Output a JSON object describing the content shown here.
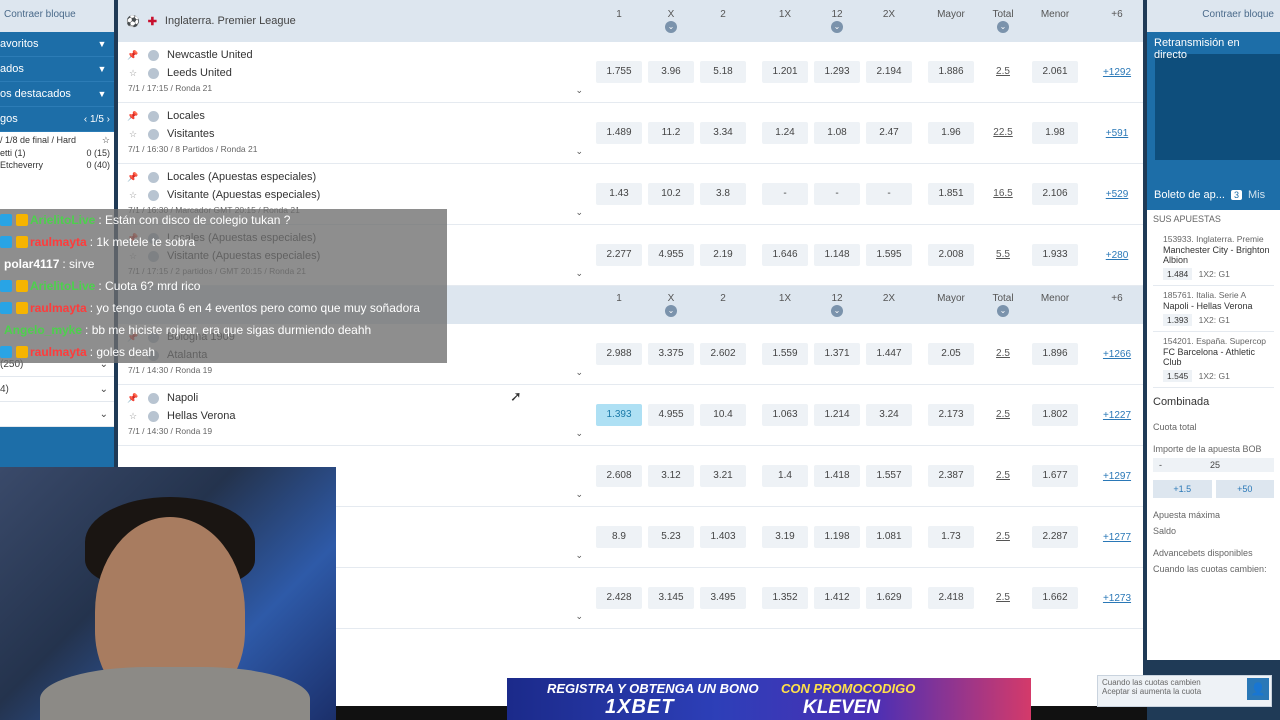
{
  "left_sidebar": {
    "collapse_label": "Contraer bloque",
    "items": [
      {
        "label": "avoritos"
      },
      {
        "label": "ados"
      },
      {
        "label": "os destacados"
      }
    ],
    "games_label": "gos",
    "games_page": "1/5",
    "live_lines": [
      {
        "left": "/ 1/8 de final / Hard",
        "right": ""
      },
      {
        "left": "etti (1)",
        "right": "0 (15)"
      },
      {
        "left": "Etcheverry",
        "right": "0 (40)"
      }
    ],
    "extra_rows": [
      {
        "label": "(250)"
      },
      {
        "label": "4)"
      },
      {
        "label": ""
      }
    ]
  },
  "league": {
    "name": "Inglaterra. Premier League",
    "columns": [
      "1",
      "X",
      "2",
      "1X",
      "12",
      "2X",
      "Mayor",
      "Total",
      "Menor",
      "+6"
    ]
  },
  "matches": [
    {
      "team1": "Newcastle United",
      "team2": "Leeds United",
      "meta": "7/1 / 17:15 / Ronda 21",
      "odds": [
        "1.755",
        "3.96",
        "5.18",
        "1.201",
        "1.293",
        "2.194",
        "1.886",
        "2.5",
        "2.061"
      ],
      "more": "+1292",
      "selected": -1
    },
    {
      "team1": "Locales",
      "team2": "Visitantes",
      "meta": "7/1 / 16:30 / 8 Partidos / Ronda 21",
      "odds": [
        "1.489",
        "11.2",
        "3.34",
        "1.24",
        "1.08",
        "2.47",
        "1.96",
        "22.5",
        "1.98"
      ],
      "more": "+591",
      "selected": -1
    },
    {
      "team1": "Locales (Apuestas especiales)",
      "team2": "Visitante (Apuestas especiales)",
      "meta": "7/1 / 16:30 / Marcador GMT 20:15 / Ronda 21",
      "odds": [
        "1.43",
        "10.2",
        "3.8",
        "-",
        "-",
        "-",
        "1.851",
        "16.5",
        "2.106"
      ],
      "more": "+529",
      "selected": -1
    },
    {
      "team1": "Locales (Apuestas especiales)",
      "team2": "Visitante (Apuestas especiales)",
      "meta": "7/1 / 17:15 / 2 partidos / GMT 20:15 / Ronda 21",
      "odds": [
        "2.277",
        "4.955",
        "2.19",
        "1.646",
        "1.148",
        "1.595",
        "2.008",
        "5.5",
        "1.933"
      ],
      "more": "+280",
      "selected": -1
    }
  ],
  "second_header_columns": [
    "1",
    "X",
    "2",
    "1X",
    "12",
    "2X",
    "Mayor",
    "Total",
    "Menor",
    "+6"
  ],
  "matches2": [
    {
      "team1": "Bologna 1909",
      "team2": "Atalanta",
      "meta": "7/1 / 14:30 / Ronda 19",
      "odds": [
        "2.988",
        "3.375",
        "2.602",
        "1.559",
        "1.371",
        "1.447",
        "2.05",
        "2.5",
        "1.896"
      ],
      "more": "+1266",
      "selected": -1
    },
    {
      "team1": "Napoli",
      "team2": "Hellas Verona",
      "meta": "7/1 / 14:30 / Ronda 19",
      "odds": [
        "1.393",
        "4.955",
        "10.4",
        "1.063",
        "1.214",
        "3.24",
        "2.173",
        "2.5",
        "1.802"
      ],
      "more": "+1227",
      "selected": 0
    },
    {
      "team1": "",
      "team2": "",
      "meta": "",
      "odds": [
        "2.608",
        "3.12",
        "3.21",
        "1.4",
        "1.418",
        "1.557",
        "2.387",
        "2.5",
        "1.677"
      ],
      "more": "+1297",
      "selected": -1
    },
    {
      "team1": "",
      "team2": "",
      "meta": "",
      "odds": [
        "8.9",
        "5.23",
        "1.403",
        "3.19",
        "1.198",
        "1.081",
        "1.73",
        "2.5",
        "2.287"
      ],
      "more": "+1277",
      "selected": -1
    },
    {
      "team1": "",
      "team2": "",
      "meta": "",
      "odds": [
        "2.428",
        "3.145",
        "3.495",
        "1.352",
        "1.412",
        "1.629",
        "2.418",
        "2.5",
        "1.662"
      ],
      "more": "+1273",
      "selected": -1
    }
  ],
  "right_panel": {
    "collapse_label": "Contraer bloque",
    "live_label": "Retransmisión en directo",
    "slip_tab": "Boleto de ap...",
    "slip_count": "3",
    "mis_tab": "Mis",
    "slip_title": "SUS APUESTAS",
    "bets": [
      {
        "league": "153933. Inglaterra. Premie",
        "teams": "Manchester City - Brighton Albion",
        "odd": "1.484",
        "pick": "1X2: G1"
      },
      {
        "league": "185761. Italia. Serie A",
        "teams": "Napoli - Hellas Verona",
        "odd": "1.393",
        "pick": "1X2: G1"
      },
      {
        "league": "154201. España. Supercop",
        "teams": "FC Barcelona - Athletic Club",
        "odd": "1.545",
        "pick": "1X2: G1"
      }
    ],
    "combo_label": "Combinada",
    "total_label": "Cuota total",
    "stake_label": "Importe de la apuesta BOB",
    "stake_minus": "-",
    "stake_value": "25",
    "quick": [
      "+1.5",
      "+50"
    ],
    "max_label": "Apuesta máxima",
    "balance_label": "Saldo",
    "advance_label": "Advancebets disponibles",
    "change_label": "Cuando las cuotas cambien:"
  },
  "chat": [
    {
      "user": "ArielitoLive",
      "msg": ": Están con disco de colegio tukan ?",
      "color": "#4cd14c",
      "badges": 2
    },
    {
      "user": "raulmayta",
      "msg": ": 1k metele te sobra",
      "color": "#ff3b3b",
      "badges": 2
    },
    {
      "user": "polar4117",
      "msg": ": sirve",
      "color": "#ffffff",
      "badges": 0
    },
    {
      "user": "ArielitoLive",
      "msg": ": Cuota 6? mrd rico",
      "color": "#4cd14c",
      "badges": 2
    },
    {
      "user": "raulmayta",
      "msg": ": yo tengo cuota 6 en 4 eventos pero como que muy soñadora",
      "color": "#ff3b3b",
      "badges": 2
    },
    {
      "user": "Angelo_myke",
      "msg": ": bb me hiciste rojear, era que sigas durmiendo deahh",
      "color": "#4cd14c",
      "badges": 0
    },
    {
      "user": "raulmayta",
      "msg": ": goles deah",
      "color": "#ff3b3b",
      "badges": 2
    }
  ],
  "ad": {
    "line1": "REGISTRA Y OBTENGA UN BONO",
    "brand": "1XBET",
    "line2": "CON PROMOCODIGO",
    "code": "KLEVEN"
  },
  "popup": {
    "line1": "Cuando las cuotas cambien",
    "line2": "Aceptar si aumenta la cuota"
  }
}
